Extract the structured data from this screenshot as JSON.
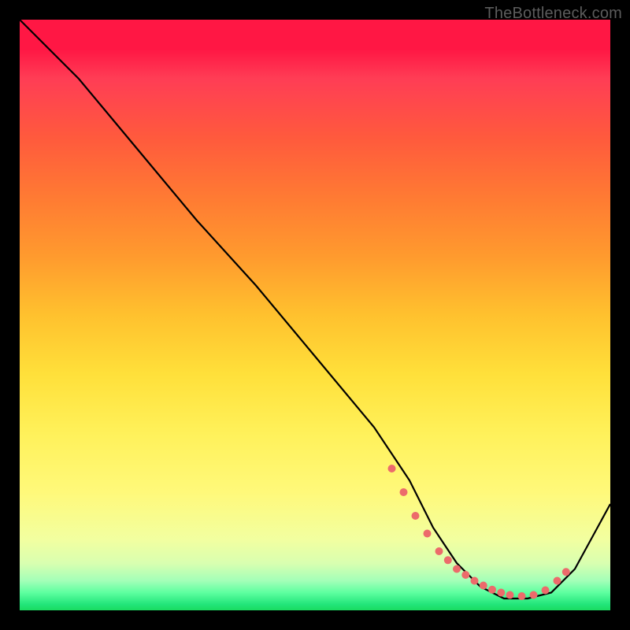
{
  "watermark": "TheBottleneck.com",
  "chart_data": {
    "type": "line",
    "title": "",
    "xlabel": "",
    "ylabel": "",
    "xlim": [
      0,
      100
    ],
    "ylim": [
      0,
      100
    ],
    "series": [
      {
        "name": "curve",
        "x": [
          0,
          6,
          10,
          20,
          30,
          40,
          50,
          60,
          66,
          70,
          74,
          78,
          82,
          86,
          90,
          94,
          100
        ],
        "y": [
          100,
          94,
          90,
          78,
          66,
          55,
          43,
          31,
          22,
          14,
          8,
          4,
          2,
          2,
          3,
          7,
          18
        ]
      }
    ],
    "markers": {
      "name": "dots",
      "x": [
        63,
        65,
        67,
        69,
        71,
        72.5,
        74,
        75.5,
        77,
        78.5,
        80,
        81.5,
        83,
        85,
        87,
        89,
        91,
        92.5
      ],
      "y": [
        24,
        20,
        16,
        13,
        10,
        8.5,
        7,
        6,
        5,
        4.2,
        3.5,
        3,
        2.6,
        2.4,
        2.6,
        3.4,
        5,
        6.5
      ]
    },
    "colors": {
      "line": "#000000",
      "marker": "#ec6b6b"
    }
  }
}
